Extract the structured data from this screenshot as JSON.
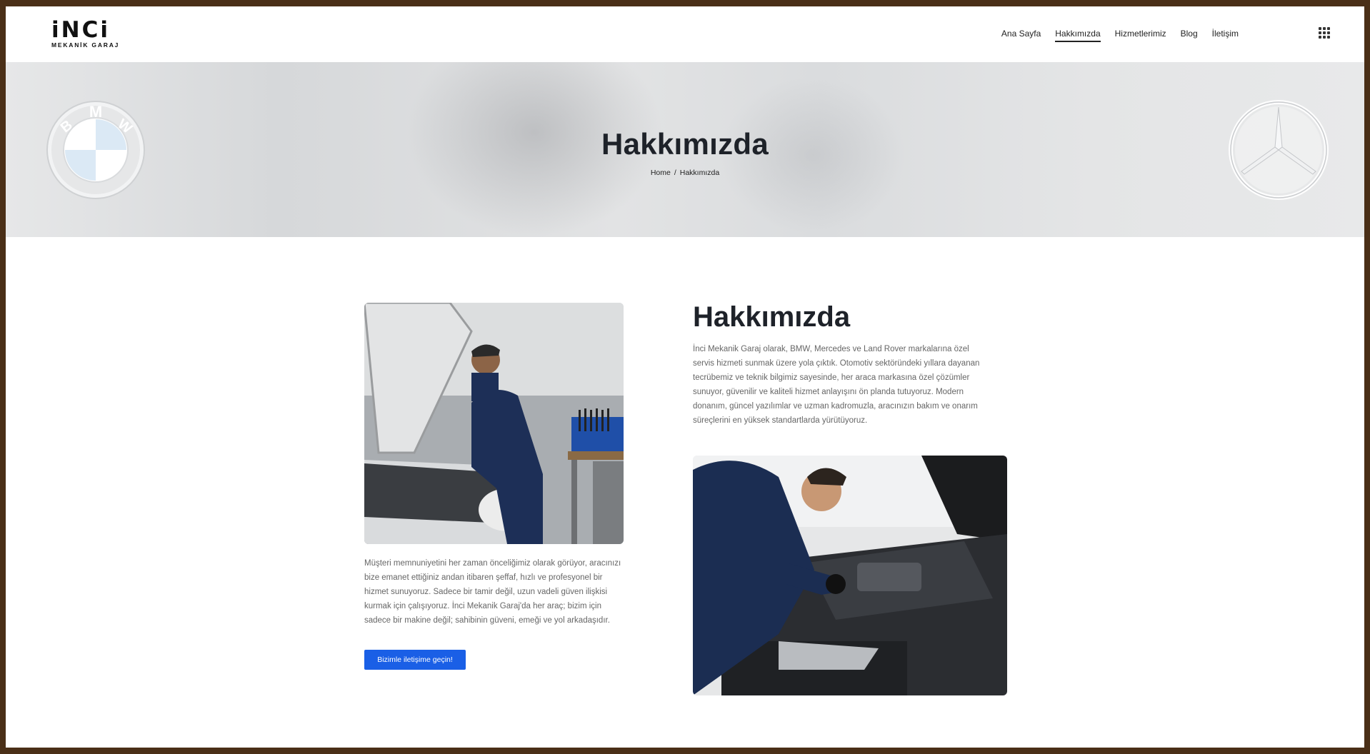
{
  "logo": {
    "main": "iNCi",
    "sub": "MEKANİK GARAJ"
  },
  "nav": [
    {
      "label": "Ana Sayfa"
    },
    {
      "label": "Hakkımızda"
    },
    {
      "label": "Hizmetlerimiz"
    },
    {
      "label": "Blog"
    },
    {
      "label": "İletişim"
    }
  ],
  "hero": {
    "title": "Hakkımızda",
    "breadcrumb": {
      "home": "Home",
      "separator": "/",
      "current": "Hakkımızda"
    },
    "bmw_letters": [
      "B",
      "M",
      "W"
    ]
  },
  "about": {
    "title": "Hakkımızda",
    "paragraph_right": "İnci Mekanik Garaj olarak, BMW, Mercedes ve Land Rover markalarına özel servis hizmeti sunmak üzere yola çıktık. Otomotiv sektöründeki yıllara dayanan tecrübemiz ve teknik bilgimiz sayesinde, her araca markasına özel çözümler sunuyor, güvenilir ve kaliteli hizmet anlayışını ön planda tutuyoruz. Modern donanım, güncel yazılımlar ve uzman kadromuzla, aracınızın bakım ve onarım süreçlerini en yüksek standartlarda yürütüyoruz.",
    "paragraph_left": "Müşteri memnuniyetini her zaman önceliğimiz olarak görüyor, aracınızı bize emanet ettiğiniz andan itibaren şeffaf, hızlı ve profesyonel bir hizmet sunuyoruz. Sadece bir tamir değil, uzun vadeli güven ilişkisi kurmak için çalışıyoruz. İnci Mekanik Garaj'da her araç; bizim için sadece bir makine değil; sahibinin güveni, emeği ve yol arkadaşıdır.",
    "cta_label": "Bizimle iletişime geçin!"
  },
  "icons": {
    "menu": "grid-menu-icon"
  },
  "colors": {
    "accent": "#1a5fe6",
    "frame": "#4a2f17",
    "heading": "#1e2229"
  }
}
